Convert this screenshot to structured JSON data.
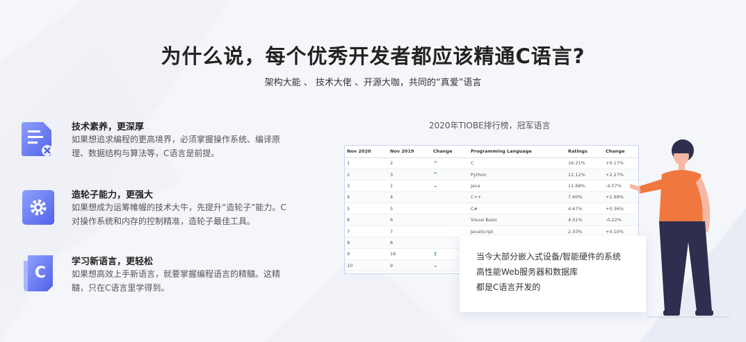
{
  "header": {
    "title": "为什么说，每个优秀开发者都应该精通C语言?",
    "subtitle": "架构大能 、 技术大佬 、开源大咖，共同的“真爱”语言"
  },
  "features": [
    {
      "icon": "document-tools-icon",
      "title": "技术素养，更深厚",
      "desc": "如果想追求编程的更高境界，必须掌握操作系统、编译原理、数据结构与算法等，C语言是前提。"
    },
    {
      "icon": "gear-icon",
      "title": "造轮子能力，更强大",
      "desc": "如果想成为运筹帷幄的技术大牛，先提升“造轮子”能力。C对操作系统和内存的控制精准，造轮子最佳工具。"
    },
    {
      "icon": "c-language-icon",
      "title": "学习新语言，更轻松",
      "desc": "如果想高效上手新语言，就要掌握编程语言的精髓。这精髓，只在C语言里学得到。"
    }
  ],
  "chart": {
    "caption": "2020年TIOBE排行榜，冠军语言",
    "columns": [
      "Nov 2020",
      "Nov 2019",
      "Change",
      "Programming Language",
      "Ratings",
      "Change"
    ],
    "rows": [
      {
        "now": "1",
        "prev": "2",
        "change": "up",
        "lang": "C",
        "rating": "16.21%",
        "delta": "+0.17%"
      },
      {
        "now": "2",
        "prev": "3",
        "change": "up",
        "lang": "Python",
        "rating": "12.12%",
        "delta": "+2.27%"
      },
      {
        "now": "3",
        "prev": "1",
        "change": "down",
        "lang": "Java",
        "rating": "11.68%",
        "delta": "-4.57%"
      },
      {
        "now": "4",
        "prev": "4",
        "change": "",
        "lang": "C++",
        "rating": "7.60%",
        "delta": "+1.99%"
      },
      {
        "now": "5",
        "prev": "5",
        "change": "",
        "lang": "C#",
        "rating": "4.67%",
        "delta": "+0.36%"
      },
      {
        "now": "6",
        "prev": "6",
        "change": "",
        "lang": "Visual Basic",
        "rating": "4.01%",
        "delta": "-0.22%"
      },
      {
        "now": "7",
        "prev": "7",
        "change": "",
        "lang": "JavaScript",
        "rating": "2.03%",
        "delta": "+0.10%"
      },
      {
        "now": "8",
        "prev": "8",
        "change": "",
        "lang": "",
        "rating": "",
        "delta": ""
      },
      {
        "now": "9",
        "prev": "16",
        "change": "up2",
        "lang": "",
        "rating": "",
        "delta": ""
      },
      {
        "now": "10",
        "prev": "9",
        "change": "down",
        "lang": "",
        "rating": "",
        "delta": ""
      }
    ],
    "change_symbols": {
      "up": "^",
      "up2": "⇑",
      "down": "⌄"
    }
  },
  "callout": {
    "lines": [
      "当今大部分嵌入式设备/智能硬件的系统",
      "高性能Web服务器和数据库",
      "都是C语言开发的"
    ]
  },
  "colors": {
    "icon_gradient_start": "#7b8cf5",
    "icon_gradient_end": "#4f63e6",
    "person_shirt": "#f0773e",
    "person_pants": "#2e2f4f"
  }
}
